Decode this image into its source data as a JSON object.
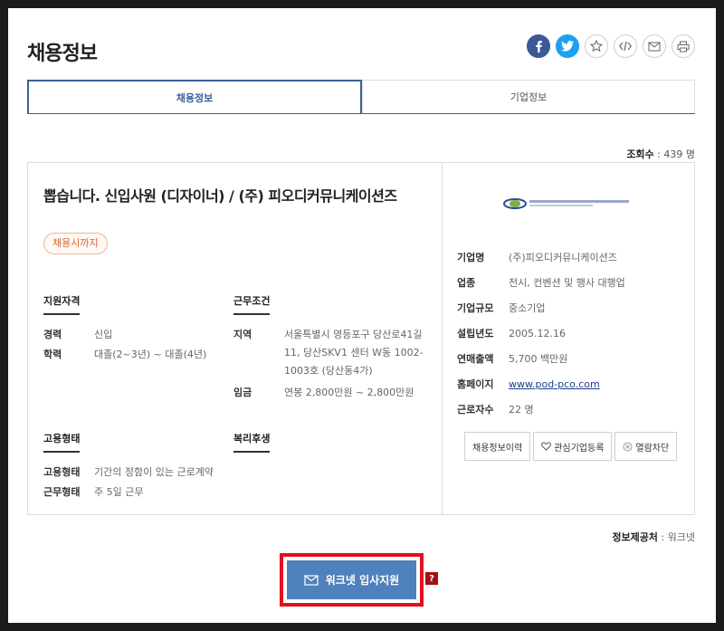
{
  "page_title": "채용정보",
  "share": {
    "facebook_icon": "facebook-icon",
    "twitter_icon": "twitter-icon",
    "star_icon": "star-icon",
    "code_icon": "code-icon",
    "mail_icon": "mail-icon",
    "print_icon": "print-icon"
  },
  "tabs": [
    {
      "label": "채용정보",
      "active": true
    },
    {
      "label": "기업정보",
      "active": false
    }
  ],
  "views": {
    "label": "조회수",
    "value": " : 439 명"
  },
  "job": {
    "title": "뽑습니다. 신입사원 (디자이너) / (주) 피오디커뮤니케이션즈",
    "deadline_badge": "채용시까지"
  },
  "qualifications": {
    "heading": "지원자격",
    "rows": [
      {
        "k": "경력",
        "v": "신입"
      },
      {
        "k": "학력",
        "v": "대졸(2~3년) ~ 대졸(4년)"
      }
    ]
  },
  "conditions": {
    "heading": "근무조건",
    "rows": [
      {
        "k": "지역",
        "v": "서울특별시 영등포구 당산로41길 11, 당산SKV1 센터 W동 1002-1003호 (당산동4가)"
      },
      {
        "k": "임금",
        "v": "연봉 2,800만원 ~ 2,800만원"
      }
    ]
  },
  "employment": {
    "heading": "고용형태",
    "rows": [
      {
        "k": "고용형태",
        "v": "기간의 정함이 있는 근로계약"
      },
      {
        "k": "근무형태",
        "v": "주 5일 근무"
      }
    ]
  },
  "welfare": {
    "heading": "복리후생"
  },
  "company": {
    "rows": [
      {
        "k": "기업명",
        "v": "(주)피오디커뮤니케이션즈"
      },
      {
        "k": "업종",
        "v": "전시, 컨벤션 및 행사 대행업"
      },
      {
        "k": "기업규모",
        "v": "중소기업"
      },
      {
        "k": "설립년도",
        "v": "2005.12.16"
      },
      {
        "k": "연매출액",
        "v": "5,700 백만원"
      },
      {
        "k": "홈페이지",
        "v": "www.pod-pco.com"
      },
      {
        "k": "근로자수",
        "v": "22 명"
      }
    ],
    "actions": [
      "채용정보이력",
      "관심기업등록",
      "열람차단"
    ]
  },
  "source": {
    "label": "정보제공처",
    "value": " : 워크넷"
  },
  "apply": {
    "label": "워크넷 입사지원",
    "help": "?"
  },
  "colors": {
    "accent": "#3c5f98",
    "apply_bg": "#4f81bd",
    "highlight": "#e3101c"
  }
}
